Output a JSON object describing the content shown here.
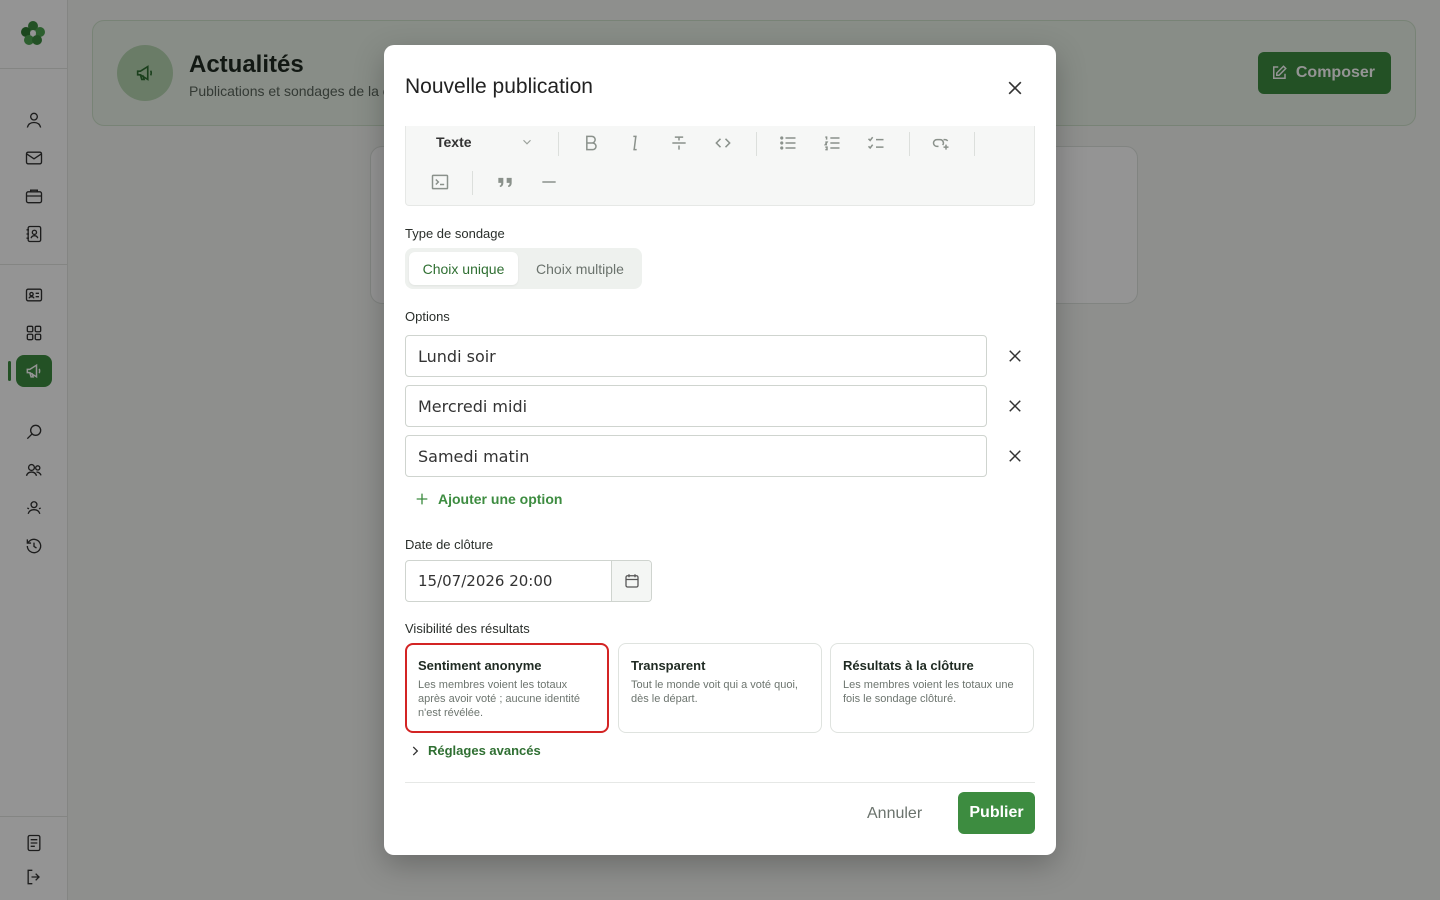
{
  "header": {
    "title": "Actualités",
    "subtitle": "Publications et sondages de la c",
    "compose_label": "Composer"
  },
  "sidebar": {
    "icons": [
      "user-icon",
      "mail-icon",
      "briefcase-icon",
      "contact-book-icon",
      "id-card-icon",
      "grid-icon",
      "megaphone-icon",
      "search-icon",
      "group-icon",
      "team-icon",
      "history-icon",
      "document-icon",
      "logout-icon"
    ],
    "active_item": "megaphone-icon"
  },
  "modal": {
    "title": "Nouvelle publication",
    "toolbar": {
      "block_type": "Texte",
      "buttons": [
        "bold",
        "italic",
        "strikethrough",
        "code",
        "bullet-list",
        "numbered-list",
        "checklist",
        "link",
        "code-block",
        "quote",
        "horizontal-rule"
      ]
    },
    "poll_type": {
      "label": "Type de sondage",
      "options": [
        "Choix unique",
        "Choix multiple"
      ],
      "selected": "Choix unique"
    },
    "options": {
      "label": "Options",
      "values": [
        "Lundi soir",
        "Mercredi midi",
        "Samedi matin"
      ],
      "add_label": "Ajouter une option"
    },
    "close_date": {
      "label": "Date de clôture",
      "value": "15/07/2026 20:00"
    },
    "visibility": {
      "label": "Visibilité des résultats",
      "cards": [
        {
          "title": "Sentiment anonyme",
          "desc": "Les membres voient les totaux après avoir voté ; aucune identité n'est révélée.",
          "selected": true
        },
        {
          "title": "Transparent",
          "desc": "Tout le monde voit qui a voté quoi, dès le départ.",
          "selected": false
        },
        {
          "title": "Résultats à la clôture",
          "desc": "Les membres voient les totaux une fois le sondage clôturé.",
          "selected": false
        }
      ]
    },
    "advanced_label": "Réglages avancés",
    "cancel_label": "Annuler",
    "publish_label": "Publier"
  },
  "colors": {
    "accent": "#3d8c40",
    "selected_border": "#d32424"
  }
}
